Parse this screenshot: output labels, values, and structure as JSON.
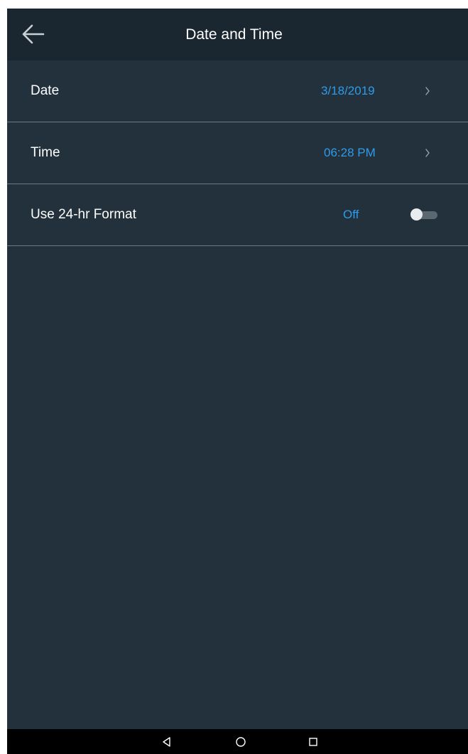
{
  "header": {
    "title": "Date and Time",
    "back_icon": "arrow-left-icon"
  },
  "settings": [
    {
      "label": "Date",
      "value": "3/18/2019",
      "control": "chevron-right-icon"
    },
    {
      "label": "Time",
      "value": "06:28 PM",
      "control": "chevron-right-icon"
    },
    {
      "label": "Use 24-hr Format",
      "value": "Off",
      "control": "toggle",
      "toggle_on": false
    }
  ],
  "nav_bar": {
    "buttons": [
      "nav-back-icon",
      "nav-home-icon",
      "nav-recents-icon"
    ]
  },
  "colors": {
    "background": "#22313b",
    "header_background": "#1a2630",
    "accent": "#2f9bea",
    "divider": "#6b7a84",
    "text": "#ffffff",
    "nav_bar": "#000000"
  }
}
